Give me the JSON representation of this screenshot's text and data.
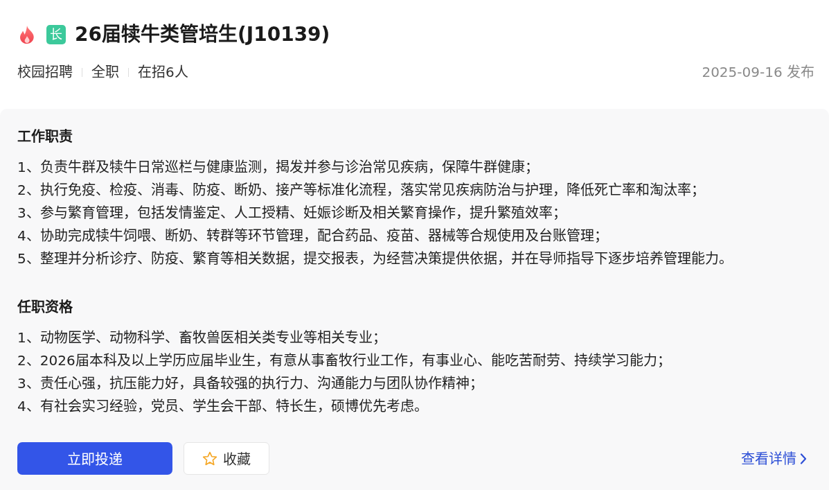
{
  "header": {
    "hot": true,
    "badge": "长",
    "title": "26届犊牛类管培生(J10139)"
  },
  "meta": {
    "tags": [
      "校园招聘",
      "全职",
      "在招6人"
    ],
    "date": "2025-09-16 发布"
  },
  "sections": [
    {
      "heading": "工作职责",
      "lines": [
        "1、负责牛群及犊牛日常巡栏与健康监测，揭发并参与诊治常见疾病，保障牛群健康；",
        "2、执行免疫、检疫、消毒、防疫、断奶、接产等标准化流程，落实常见疾病防治与护理，降低死亡率和淘汰率；",
        "3、参与繁育管理，包括发情鉴定、人工授精、妊娠诊断及相关繁育操作，提升繁殖效率；",
        "4、协助完成犊牛饲喂、断奶、转群等环节管理，配合药品、疫苗、器械等合规使用及台账管理；",
        "5、整理并分析诊疗、防疫、繁育等相关数据，提交报表，为经营决策提供依据，并在导师指导下逐步培养管理能力。"
      ]
    },
    {
      "heading": "任职资格",
      "lines": [
        "1、动物医学、动物科学、畜牧兽医相关类专业等相关专业；",
        "2、2026届本科及以上学历应届毕业生，有意从事畜牧行业工作，有事业心、能吃苦耐劳、持续学习能力；",
        "3、责任心强，抗压能力好，具备较强的执行力、沟通能力与团队协作精神；",
        "4、有社会实习经验，党员、学生会干部、特长生，硕博优先考虑。"
      ]
    }
  ],
  "actions": {
    "apply": "立即投递",
    "collect": {
      "label": "收藏",
      "saved": false
    },
    "details": "查看详情"
  }
}
